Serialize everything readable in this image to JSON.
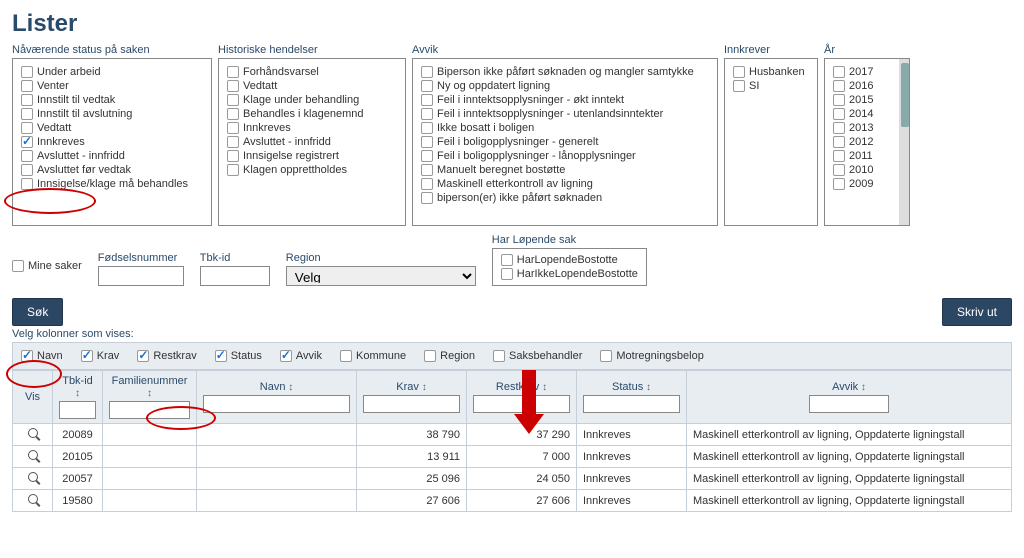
{
  "title": "Lister",
  "filters": {
    "status": {
      "label": "Nåværende status på saken",
      "items": [
        {
          "label": "Under arbeid",
          "checked": false
        },
        {
          "label": "Venter",
          "checked": false
        },
        {
          "label": "Innstilt til vedtak",
          "checked": false
        },
        {
          "label": "Innstilt til avslutning",
          "checked": false
        },
        {
          "label": "Vedtatt",
          "checked": false
        },
        {
          "label": "Innkreves",
          "checked": true
        },
        {
          "label": "Avsluttet - innfridd",
          "checked": false
        },
        {
          "label": "Avsluttet før vedtak",
          "checked": false
        },
        {
          "label": "Innsigelse/klage må behandles",
          "checked": false
        }
      ]
    },
    "historic": {
      "label": "Historiske hendelser",
      "items": [
        {
          "label": "Forhåndsvarsel",
          "checked": false
        },
        {
          "label": "Vedtatt",
          "checked": false
        },
        {
          "label": "Klage under behandling",
          "checked": false
        },
        {
          "label": "Behandles i klagenemnd",
          "checked": false
        },
        {
          "label": "Innkreves",
          "checked": false
        },
        {
          "label": "Avsluttet - innfridd",
          "checked": false
        },
        {
          "label": "Innsigelse registrert",
          "checked": false
        },
        {
          "label": "Klagen opprettholdes",
          "checked": false
        }
      ]
    },
    "avvik": {
      "label": "Avvik",
      "items": [
        {
          "label": "Biperson ikke påført søknaden og mangler samtykke",
          "checked": false
        },
        {
          "label": "Ny og oppdatert ligning",
          "checked": false
        },
        {
          "label": "Feil i inntektsopplysninger - økt inntekt",
          "checked": false
        },
        {
          "label": "Feil i inntektsopplysninger - utenlandsinntekter",
          "checked": false
        },
        {
          "label": "Ikke bosatt i boligen",
          "checked": false
        },
        {
          "label": "Feil i boligopplysninger - generelt",
          "checked": false
        },
        {
          "label": "Feil i boligopplysninger - lånopplysninger",
          "checked": false
        },
        {
          "label": "Manuelt beregnet bostøtte",
          "checked": false
        },
        {
          "label": "Maskinell etterkontroll av ligning",
          "checked": false
        },
        {
          "label": "biperson(er) ikke påført søknaden",
          "checked": false
        }
      ]
    },
    "innkrever": {
      "label": "Innkrever",
      "items": [
        {
          "label": "Husbanken",
          "checked": false
        },
        {
          "label": "SI",
          "checked": false
        }
      ]
    },
    "year": {
      "label": "År",
      "items": [
        {
          "label": "2017",
          "checked": false
        },
        {
          "label": "2016",
          "checked": false
        },
        {
          "label": "2015",
          "checked": false
        },
        {
          "label": "2014",
          "checked": false
        },
        {
          "label": "2013",
          "checked": false
        },
        {
          "label": "2012",
          "checked": false
        },
        {
          "label": "2011",
          "checked": false
        },
        {
          "label": "2010",
          "checked": false
        },
        {
          "label": "2009",
          "checked": false
        }
      ]
    }
  },
  "row2": {
    "mine_saker": "Mine saker",
    "fnr_label": "Fødselsnummer",
    "tbk_label": "Tbk-id",
    "region_label": "Region",
    "region_value": "Velg",
    "lopende_label": "Har Løpende sak",
    "lopende1": "HarLopendeBostotte",
    "lopende2": "HarIkkeLopendeBostotte"
  },
  "buttons": {
    "search": "Søk",
    "print": "Skriv ut"
  },
  "columns_header": "Velg kolonner som vises:",
  "columns": [
    {
      "label": "Navn",
      "checked": true
    },
    {
      "label": "Krav",
      "checked": true
    },
    {
      "label": "Restkrav",
      "checked": true
    },
    {
      "label": "Status",
      "checked": true
    },
    {
      "label": "Avvik",
      "checked": true
    },
    {
      "label": "Kommune",
      "checked": false
    },
    {
      "label": "Region",
      "checked": false
    },
    {
      "label": "Saksbehandler",
      "checked": false
    },
    {
      "label": "Motregningsbelop",
      "checked": false
    }
  ],
  "table": {
    "headers": {
      "vis": "Vis",
      "tbkid": "Tbk-id",
      "familienr": "Familienummer",
      "navn": "Navn",
      "krav": "Krav",
      "restkrav": "Restkrav",
      "status": "Status",
      "avvik": "Avvik"
    },
    "rows": [
      {
        "tbkid": "20089",
        "krav": "38 790",
        "restkrav": "37 290",
        "status": "Innkreves",
        "avvik": "Maskinell etterkontroll av ligning, Oppdaterte ligningstall"
      },
      {
        "tbkid": "20105",
        "krav": "13 911",
        "restkrav": "7 000",
        "status": "Innkreves",
        "avvik": "Maskinell etterkontroll av ligning, Oppdaterte ligningstall"
      },
      {
        "tbkid": "20057",
        "krav": "25 096",
        "restkrav": "24 050",
        "status": "Innkreves",
        "avvik": "Maskinell etterkontroll av ligning, Oppdaterte ligningstall"
      },
      {
        "tbkid": "19580",
        "krav": "27 606",
        "restkrav": "27 606",
        "status": "Innkreves",
        "avvik": "Maskinell etterkontroll av ligning, Oppdaterte ligningstall"
      }
    ]
  }
}
